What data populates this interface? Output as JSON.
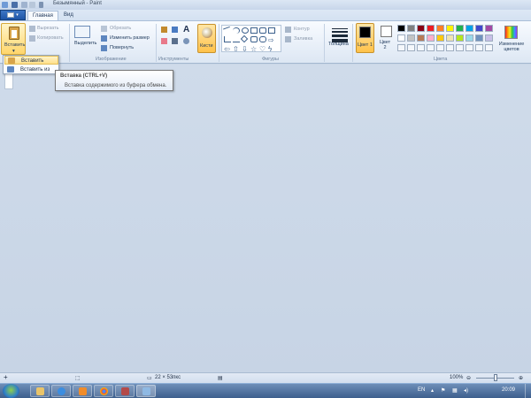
{
  "window": {
    "title": "Безымянный - Paint"
  },
  "tabs": {
    "file_label": "",
    "home": "Главная",
    "view": "Вид"
  },
  "clipboard": {
    "paste_label": "Вставить",
    "cut_label": "Вырезать",
    "copy_label": "Копировать"
  },
  "image": {
    "group_label": "Изображение",
    "select_label": "Выделить",
    "crop_label": "Обрезать",
    "resize_label": "Изменить размер",
    "rotate_label": "Повернуть"
  },
  "tools": {
    "group_label": "Инструменты",
    "brushes_label": "Кисти"
  },
  "shapes": {
    "group_label": "Фигуры",
    "outline_label": "Контур",
    "fill_label": "Заливка"
  },
  "size": {
    "label": "Толщина"
  },
  "colors": {
    "group_label": "Цвета",
    "color1_label": "Цвет 1",
    "color2_label": "Цвет 2",
    "edit_label": "Изменение цветов",
    "palette_row1": [
      "#000000",
      "#7f7f7f",
      "#880015",
      "#ed1c24",
      "#ff7f27",
      "#fff200",
      "#22b14c",
      "#00a2e8",
      "#3f48cc",
      "#a349a4"
    ],
    "palette_row2": [
      "#ffffff",
      "#c3c3c3",
      "#b97a57",
      "#ffaec9",
      "#ffc90e",
      "#efe4b0",
      "#b5e61d",
      "#99d9ea",
      "#7092be",
      "#c8bfe7"
    ]
  },
  "paste_menu": {
    "item1": "Вставить",
    "item2": "Вставить из"
  },
  "tooltip": {
    "title": "Вставка (CTRL+V)",
    "body": "Вставка содержимого из буфера обмена."
  },
  "status": {
    "size": "22 × 53пкс",
    "zoom": "100%"
  },
  "taskbar": {
    "lang": "EN",
    "time": "20:09"
  }
}
